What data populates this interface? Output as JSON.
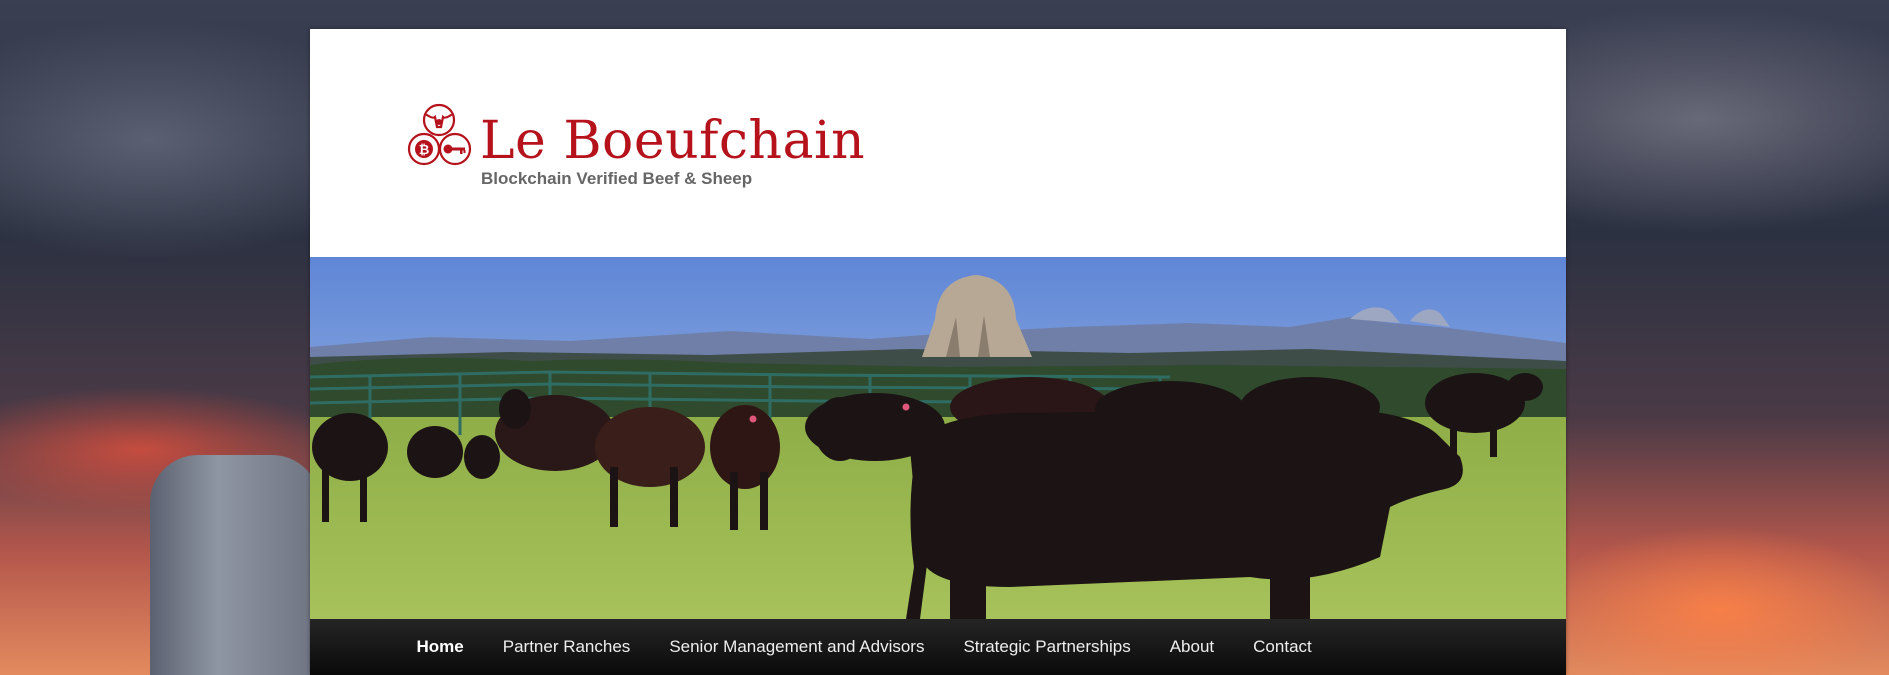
{
  "site": {
    "title": "Le Boeufchain",
    "tagline": "Blockchain Verified Beef & Sheep",
    "brand_color": "#b5121b"
  },
  "logo": {
    "icons": [
      "longhorn-icon",
      "bitcoin-icon",
      "key-icon"
    ]
  },
  "header_image": {
    "subject": "black angus cattle herd in green pasture with butte and mountains behind"
  },
  "nav": {
    "items": [
      {
        "label": "Home",
        "current": true
      },
      {
        "label": "Partner Ranches"
      },
      {
        "label": "Senior Management and Advisors"
      },
      {
        "label": "Strategic Partnerships"
      },
      {
        "label": "About"
      },
      {
        "label": "Contact"
      }
    ]
  },
  "colors": {
    "nav_background": "#111111",
    "tagline": "#666666",
    "page_background": "#ffffff"
  }
}
